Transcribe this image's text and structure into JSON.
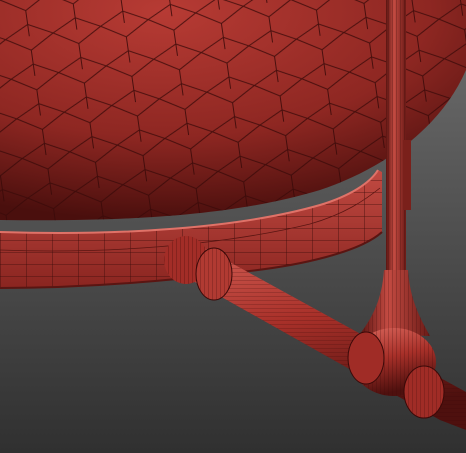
{
  "viewport": {
    "description_visible_text": "",
    "background_top": "#6e6e6e",
    "background_bottom": "#323232"
  },
  "model": {
    "surface_color": "#b23a32",
    "surface_dark": "#3f0c0b",
    "wire_color": "#2a0606",
    "highlight": "#d06055"
  },
  "icons": {
    "scene": "wireframe-mesh-icon"
  }
}
